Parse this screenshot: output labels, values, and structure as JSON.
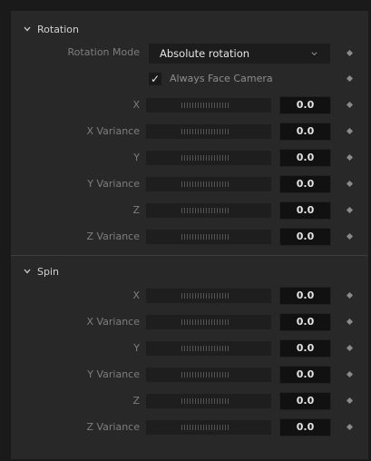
{
  "rotation": {
    "title": "Rotation",
    "mode_label": "Rotation Mode",
    "mode_value": "Absolute rotation",
    "always_face_camera_label": "Always Face Camera",
    "always_face_camera_checked": true,
    "rows": [
      {
        "label": "X",
        "value": "0.0"
      },
      {
        "label": "X Variance",
        "value": "0.0"
      },
      {
        "label": "Y",
        "value": "0.0"
      },
      {
        "label": "Y Variance",
        "value": "0.0"
      },
      {
        "label": "Z",
        "value": "0.0"
      },
      {
        "label": "Z Variance",
        "value": "0.0"
      }
    ]
  },
  "spin": {
    "title": "Spin",
    "rows": [
      {
        "label": "X",
        "value": "0.0"
      },
      {
        "label": "X Variance",
        "value": "0.0"
      },
      {
        "label": "Y",
        "value": "0.0"
      },
      {
        "label": "Y Variance",
        "value": "0.0"
      },
      {
        "label": "Z",
        "value": "0.0"
      },
      {
        "label": "Z Variance",
        "value": "0.0"
      }
    ]
  },
  "icons": {
    "section_toggle": "chevron-down-icon",
    "dropdown": "chevron-down-icon",
    "keyframe": "diamond-icon",
    "checkbox": "checkmark-icon"
  },
  "colors": {
    "panel_bg": "#282828",
    "outer_bg": "#1a1a1a",
    "field_bg": "#111111",
    "label": "#7e7e7e"
  }
}
